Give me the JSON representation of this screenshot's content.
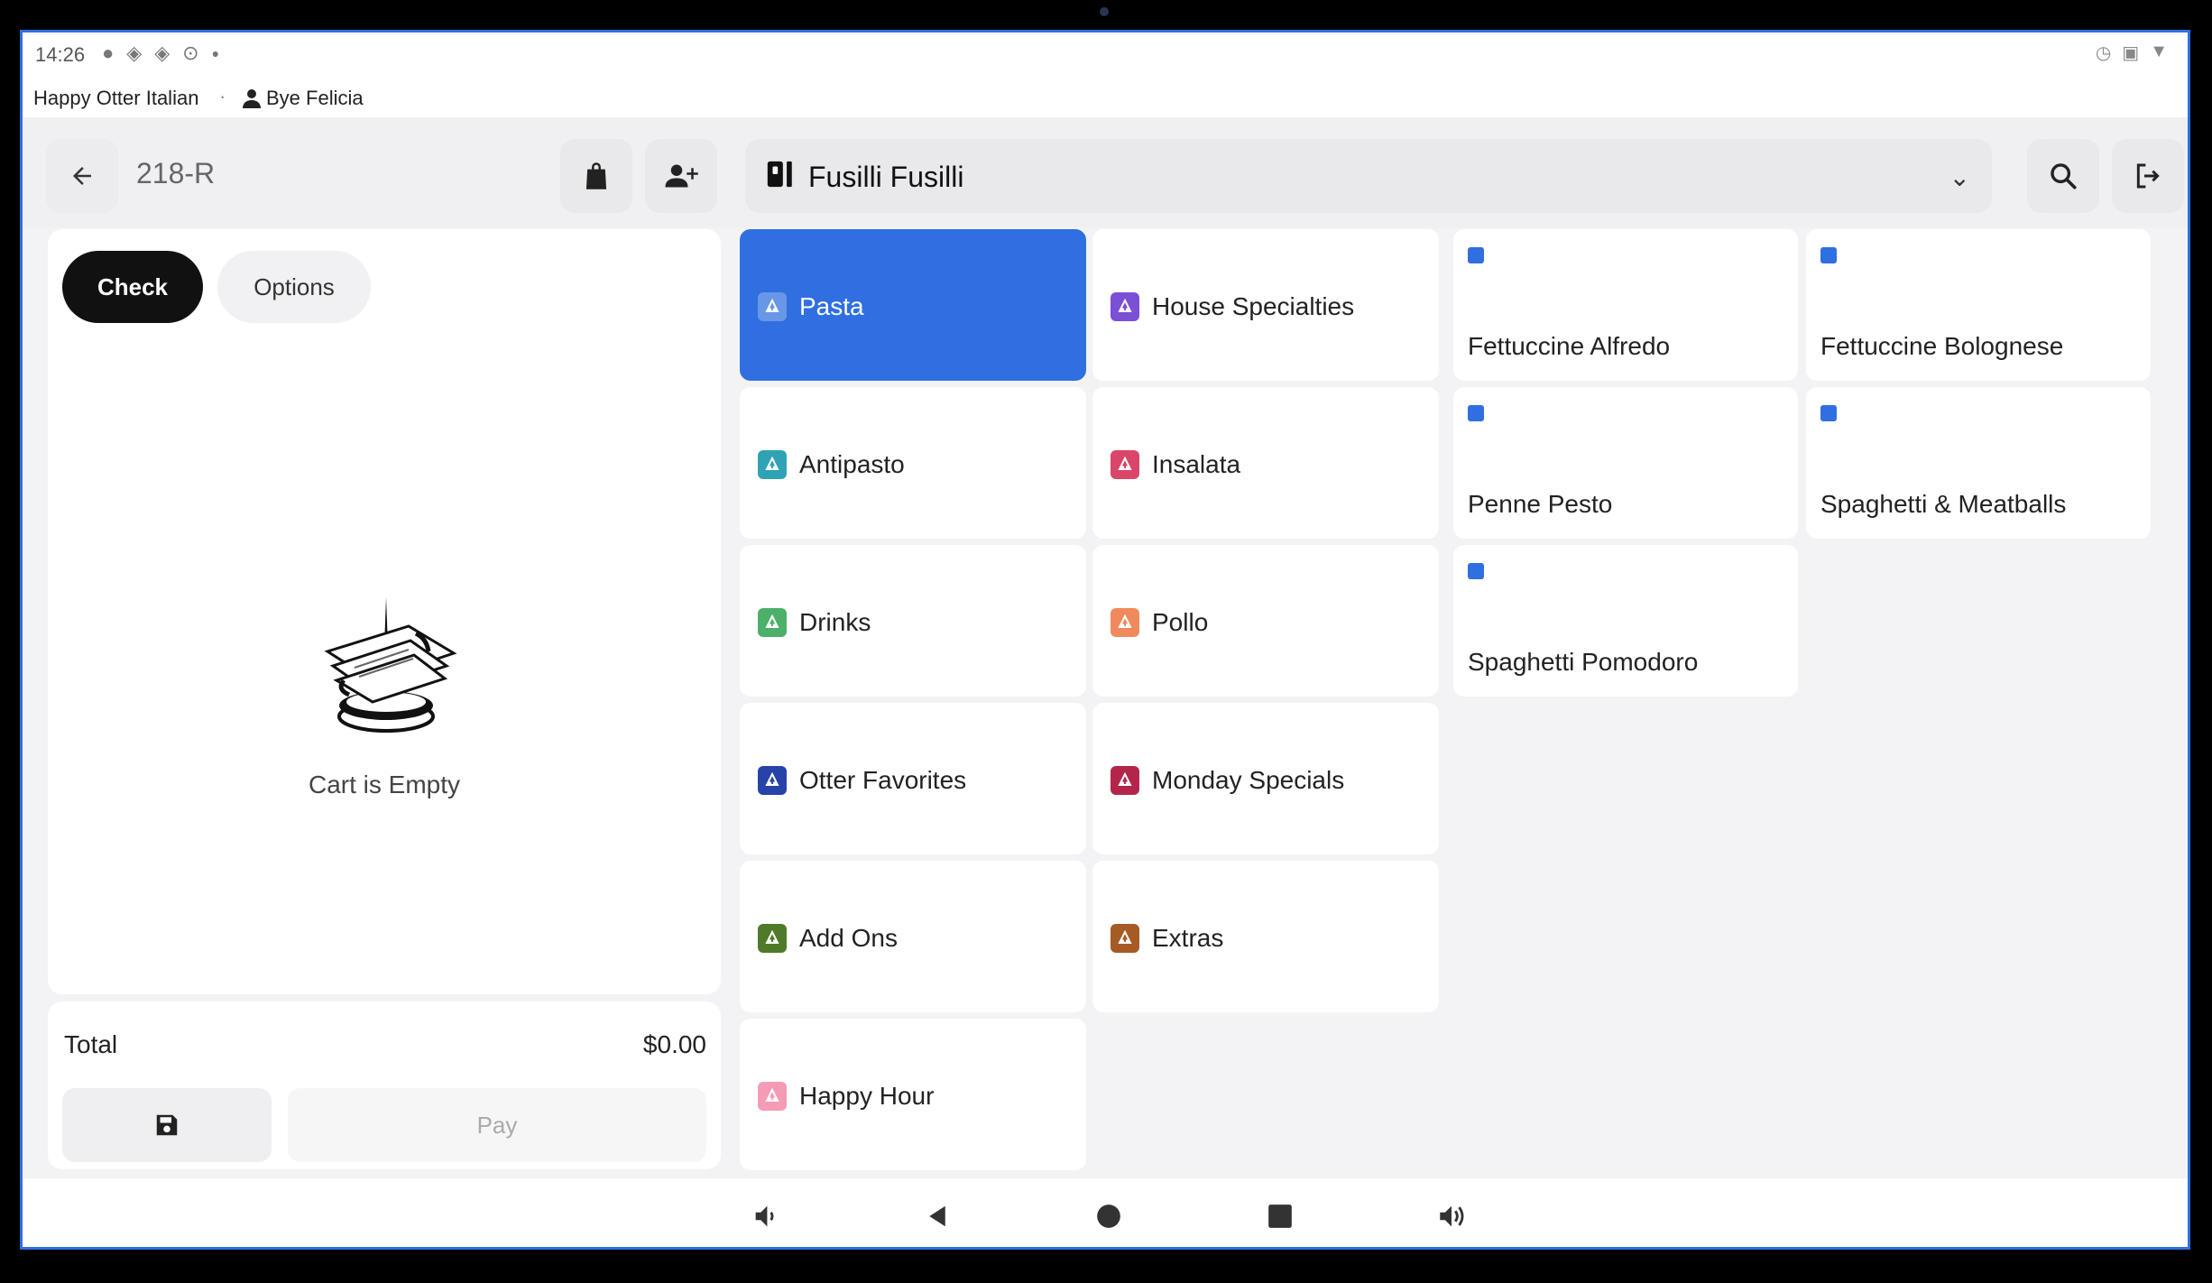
{
  "status_bar": {
    "time": "14:26"
  },
  "info_bar": {
    "restaurant": "Happy Otter Italian",
    "separator": "·",
    "user": "Bye Felicia"
  },
  "header": {
    "order_id": "218-R",
    "menu_name": "Fusilli Fusilli"
  },
  "cart": {
    "tab_check": "Check",
    "tab_options": "Options",
    "empty_text": "Cart is Empty",
    "total_label": "Total",
    "total_value": "$0.00",
    "pay_label": "Pay"
  },
  "categories": [
    {
      "label": "Pasta",
      "color": "#ffffff",
      "active": true
    },
    {
      "label": "House Specialties",
      "color": "#7b4fd6"
    },
    {
      "label": "Antipasto",
      "color": "#2fa3b5"
    },
    {
      "label": "Insalata",
      "color": "#d9466a"
    },
    {
      "label": "Drinks",
      "color": "#4caf6a"
    },
    {
      "label": "Pollo",
      "color": "#f08a5d"
    },
    {
      "label": "Otter Favorites",
      "color": "#2742a8"
    },
    {
      "label": "Monday Specials",
      "color": "#b3264a"
    },
    {
      "label": "Add Ons",
      "color": "#4f7a2a"
    },
    {
      "label": "Extras",
      "color": "#a65a24"
    },
    {
      "label": "Happy Hour",
      "color": "#f59bb5"
    }
  ],
  "items": [
    {
      "label": "Fettuccine Alfredo"
    },
    {
      "label": "Fettuccine Bolognese"
    },
    {
      "label": "Penne Pesto"
    },
    {
      "label": "Spaghetti & Meatballs"
    },
    {
      "label": "Spaghetti Pomodoro"
    }
  ],
  "colors": {
    "accent": "#2f6fe0",
    "frame": "#2f6fe0"
  },
  "icons": {
    "back": "arrow-left-icon",
    "bag": "shopping-bag-icon",
    "add_guest": "person-add-icon",
    "menu": "menu-book-icon",
    "search": "search-icon",
    "logout": "logout-icon",
    "save": "save-icon"
  }
}
